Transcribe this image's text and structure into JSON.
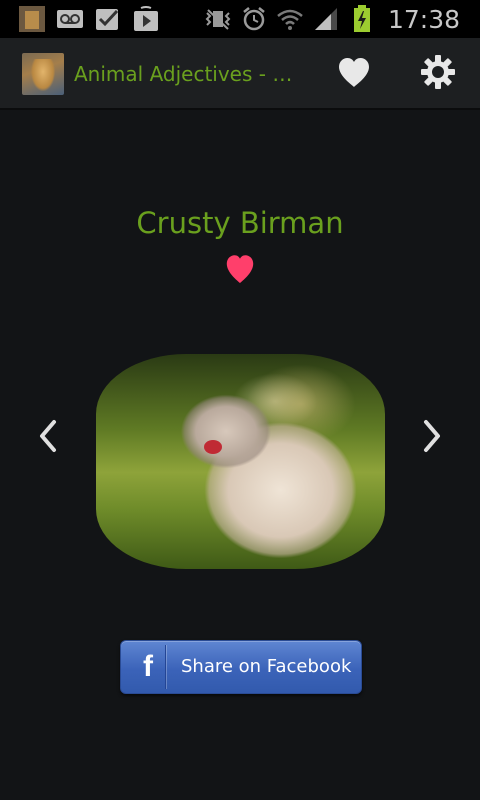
{
  "status_bar": {
    "time": "17:38",
    "icons": [
      "cat-thumbnail-icon",
      "voicemail-icon",
      "checkbox-icon",
      "play-store-icon",
      "vibrate-off-icon",
      "alarm-icon",
      "wifi-icon",
      "signal-icon",
      "battery-charging-icon"
    ]
  },
  "action_bar": {
    "title": "Animal Adjectives - Fa…",
    "icons": [
      "heart-icon",
      "gear-icon"
    ]
  },
  "content": {
    "animal_name": "Crusty Birman",
    "favorite_icon": "heart-icon",
    "prev_icon": "chevron-left-icon",
    "next_icon": "chevron-right-icon"
  },
  "share_button": {
    "label": "Share on Facebook",
    "logo_letter": "f"
  },
  "colors": {
    "accent_green": "#6aa01e",
    "heart_pink": "#ff3f6b",
    "facebook_blue": "#3b63b9",
    "background": "#121416"
  }
}
